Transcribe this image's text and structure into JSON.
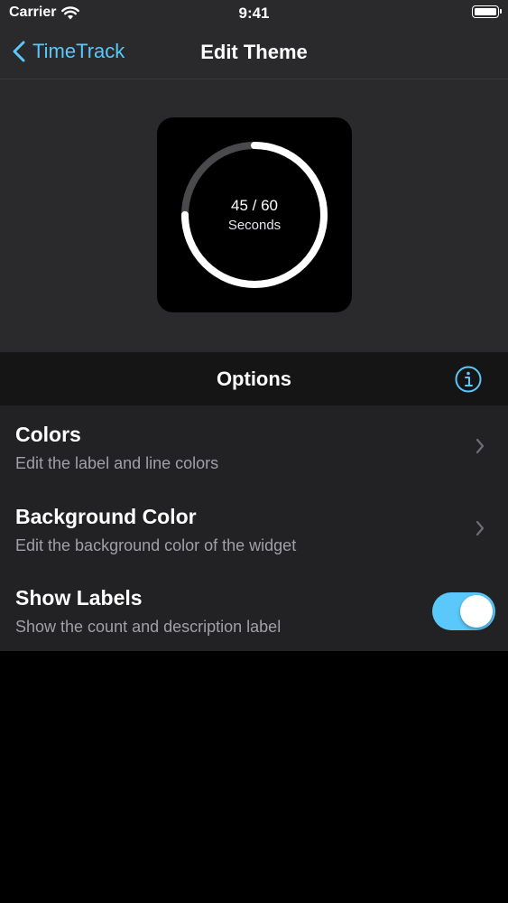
{
  "status_bar": {
    "carrier": "Carrier",
    "time": "9:41",
    "wifi_icon": "wifi-icon",
    "battery_icon": "battery-icon"
  },
  "nav": {
    "back_label": "TimeTrack",
    "title": "Edit Theme"
  },
  "widget_preview": {
    "count_label": "45 / 60",
    "description_label": "Seconds",
    "progress": 0.75,
    "ring_color": "#ffffff",
    "track_color": "#4a4a4c",
    "background_color": "#000000"
  },
  "options": {
    "header": "Options",
    "info_icon": "info-icon",
    "items": [
      {
        "title": "Colors",
        "subtitle": "Edit the label and line colors",
        "accessory": "chevron-right-icon"
      },
      {
        "title": "Background Color",
        "subtitle": "Edit the background color of the widget",
        "accessory": "chevron-right-icon"
      },
      {
        "title": "Show Labels",
        "subtitle": "Show the count and description label",
        "accessory": "toggle",
        "toggle_on": true
      }
    ]
  },
  "colors": {
    "accent": "#5ac8fa",
    "nav_background": "#2a2a2c",
    "list_background": "#222224",
    "header_background": "#151515"
  }
}
